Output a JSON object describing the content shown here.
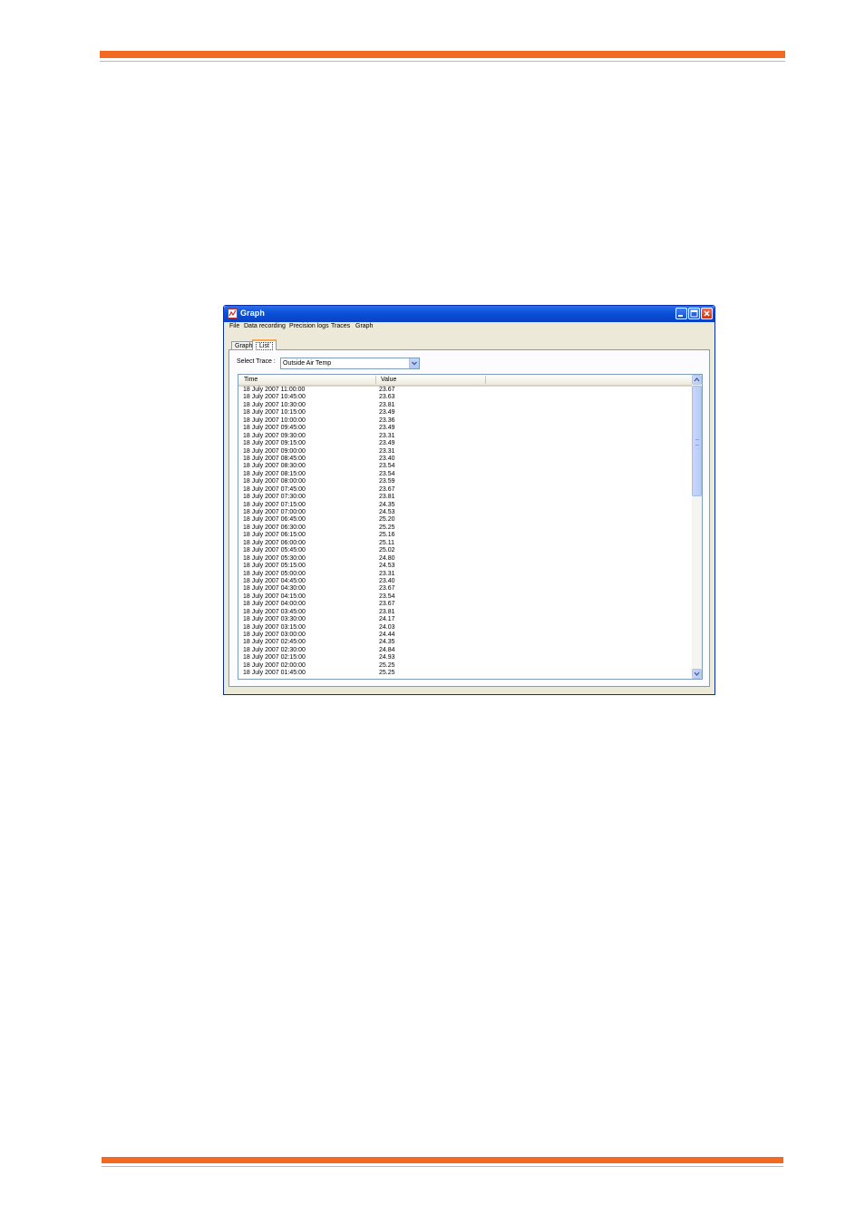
{
  "window": {
    "title": "Graph",
    "menu": [
      "File",
      "Data recording",
      "Precision logs",
      "Traces",
      "Graph"
    ],
    "tabs": [
      "Graph",
      "List"
    ],
    "active_tab": "List"
  },
  "select_trace": {
    "label": "Select Trace :",
    "value": "Outside Air Temp"
  },
  "list": {
    "columns": [
      "Time",
      "Value"
    ],
    "rows": [
      {
        "time": "18 July 2007 11:00:00",
        "value": "23.67"
      },
      {
        "time": "18 July 2007 10:45:00",
        "value": "23.63"
      },
      {
        "time": "18 July 2007 10:30:00",
        "value": "23.81"
      },
      {
        "time": "18 July 2007 10:15:00",
        "value": "23.49"
      },
      {
        "time": "18 July 2007 10:00:00",
        "value": "23.36"
      },
      {
        "time": "18 July 2007 09:45:00",
        "value": "23.49"
      },
      {
        "time": "18 July 2007 09:30:00",
        "value": "23.31"
      },
      {
        "time": "18 July 2007 09:15:00",
        "value": "23.49"
      },
      {
        "time": "18 July 2007 09:00:00",
        "value": "23.31"
      },
      {
        "time": "18 July 2007 08:45:00",
        "value": "23.40"
      },
      {
        "time": "18 July 2007 08:30:00",
        "value": "23.54"
      },
      {
        "time": "18 July 2007 08:15:00",
        "value": "23.54"
      },
      {
        "time": "18 July 2007 08:00:00",
        "value": "23.59"
      },
      {
        "time": "18 July 2007 07:45:00",
        "value": "23.67"
      },
      {
        "time": "18 July 2007 07:30:00",
        "value": "23.81"
      },
      {
        "time": "18 July 2007 07:15:00",
        "value": "24.35"
      },
      {
        "time": "18 July 2007 07:00:00",
        "value": "24.53"
      },
      {
        "time": "18 July 2007 06:45:00",
        "value": "25.20"
      },
      {
        "time": "18 July 2007 06:30:00",
        "value": "25.25"
      },
      {
        "time": "18 July 2007 06:15:00",
        "value": "25.16"
      },
      {
        "time": "18 July 2007 06:00:00",
        "value": "25.11"
      },
      {
        "time": "18 July 2007 05:45:00",
        "value": "25.02"
      },
      {
        "time": "18 July 2007 05:30:00",
        "value": "24.80"
      },
      {
        "time": "18 July 2007 05:15:00",
        "value": "24.53"
      },
      {
        "time": "18 July 2007 05:00:00",
        "value": "23.31"
      },
      {
        "time": "18 July 2007 04:45:00",
        "value": "23.40"
      },
      {
        "time": "18 July 2007 04:30:00",
        "value": "23.67"
      },
      {
        "time": "18 July 2007 04:15:00",
        "value": "23.54"
      },
      {
        "time": "18 July 2007 04:00:00",
        "value": "23.67"
      },
      {
        "time": "18 July 2007 03:45:00",
        "value": "23.81"
      },
      {
        "time": "18 July 2007 03:30:00",
        "value": "24.17"
      },
      {
        "time": "18 July 2007 03:15:00",
        "value": "24.03"
      },
      {
        "time": "18 July 2007 03:00:00",
        "value": "24.44"
      },
      {
        "time": "18 July 2007 02:45:00",
        "value": "24.35"
      },
      {
        "time": "18 July 2007 02:30:00",
        "value": "24.84"
      },
      {
        "time": "18 July 2007 02:15:00",
        "value": "24.93"
      },
      {
        "time": "18 July 2007 02:00:00",
        "value": "25.25"
      },
      {
        "time": "18 July 2007 01:45:00",
        "value": "25.25"
      }
    ]
  },
  "colors": {
    "page_rule": "#f26a22",
    "titlebar": "#0a50d8",
    "window_face": "#ece9d8",
    "active_tab_accent": "#f4a84a"
  },
  "icons": {
    "app": "graph-app-icon",
    "minimize": "minimize-icon",
    "maximize": "maximize-icon",
    "close": "close-icon",
    "dropdown": "chevron-down-icon",
    "scroll_up": "scroll-up-arrow-icon",
    "scroll_down": "scroll-down-arrow-icon"
  }
}
